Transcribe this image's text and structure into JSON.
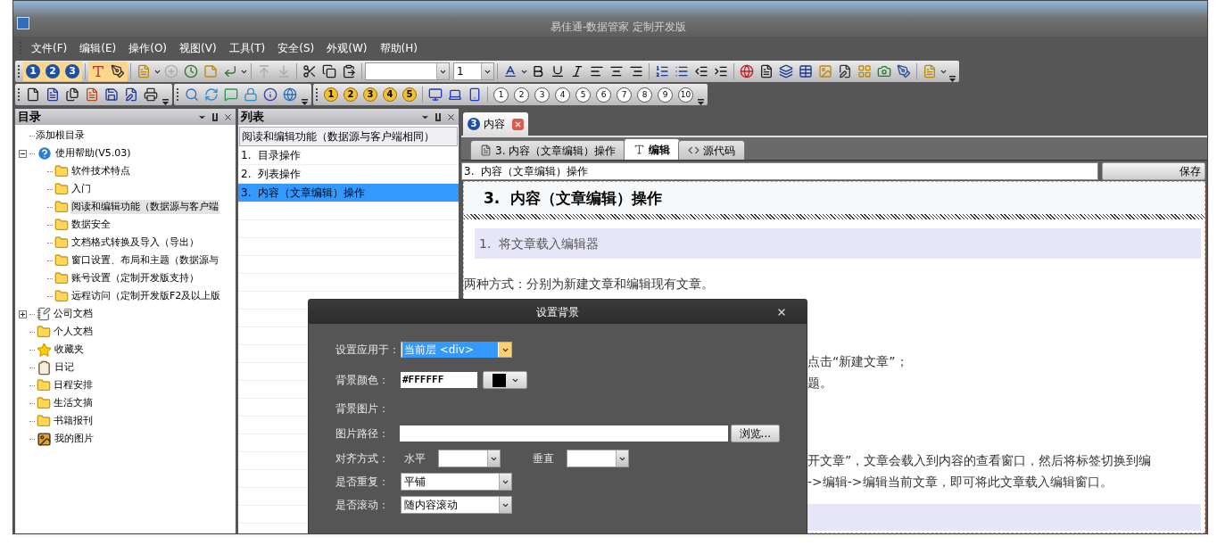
{
  "window": {
    "title": "易佳通-数据管家 定制开发版"
  },
  "menu": [
    "文件(F)",
    "编辑(E)",
    "操作(O)",
    "视图(V)",
    "工具(T)",
    "安全(S)",
    "外观(W)",
    "帮助(H)"
  ],
  "toolbar1": {
    "level_buttons": [
      "1",
      "2",
      "3"
    ],
    "size_field": {
      "value": "1"
    }
  },
  "toolbar2": {
    "yellow_numbers": [
      "1",
      "2",
      "3",
      "4",
      "5"
    ],
    "white_numbers": [
      "1",
      "2",
      "3",
      "4",
      "5",
      "6",
      "7",
      "8",
      "9",
      "10"
    ]
  },
  "directory_panel": {
    "title": "目录",
    "tree": [
      {
        "label": "添加根目录",
        "kind": "plain",
        "selected": false
      },
      {
        "label": "使用帮助(V5.03)",
        "kind": "help",
        "selected": false,
        "expanded": true,
        "children": [
          {
            "label": "软件技术特点",
            "kind": "doc-folder",
            "selected": false
          },
          {
            "label": "入门",
            "kind": "doc-folder",
            "selected": false
          },
          {
            "label": "阅读和编辑功能（数据源与客户端",
            "kind": "doc-folder",
            "selected": true
          },
          {
            "label": "数据安全",
            "kind": "doc-folder",
            "selected": false
          },
          {
            "label": "文档格式转换及导入（导出）",
            "kind": "doc-folder",
            "selected": false
          },
          {
            "label": "窗口设置、布局和主题（数据源与",
            "kind": "doc-folder",
            "selected": false
          },
          {
            "label": "账号设置（定制开发版支持）",
            "kind": "doc-folder",
            "selected": false
          },
          {
            "label": "远程访问（定制开发版F2及以上版",
            "kind": "doc-folder",
            "selected": false
          }
        ]
      },
      {
        "label": "公司文档",
        "kind": "note",
        "selected": false,
        "expanded": false
      },
      {
        "label": "个人文档",
        "kind": "folder",
        "selected": false
      },
      {
        "label": "收藏夹",
        "kind": "star",
        "selected": false
      },
      {
        "label": "日记",
        "kind": "clipboard",
        "selected": false
      },
      {
        "label": "日程安排",
        "kind": "folder",
        "selected": false
      },
      {
        "label": "生活文摘",
        "kind": "folder",
        "selected": false
      },
      {
        "label": "书籍报刊",
        "kind": "folder",
        "selected": false
      },
      {
        "label": "我的图片",
        "kind": "picture",
        "selected": false
      }
    ]
  },
  "list_panel": {
    "title": "列表",
    "header": "阅读和编辑功能（数据源与客户端相同）",
    "items": [
      {
        "label": "1.  目录操作",
        "selected": false
      },
      {
        "label": "2.  列表操作",
        "selected": false
      },
      {
        "label": "3.  内容（文章编辑）操作",
        "selected": true
      }
    ]
  },
  "document_tab": {
    "number": "3",
    "label": "内容"
  },
  "view_tabs": [
    {
      "label": "3. 内容（文章编辑）操作",
      "kind": "view",
      "selected": false
    },
    {
      "label": "编辑",
      "kind": "edit",
      "selected": true
    },
    {
      "label": "源代码",
      "kind": "source",
      "selected": false
    }
  ],
  "title_field": {
    "value": "3.  内容（文章编辑）操作"
  },
  "save_button": {
    "label": "保存"
  },
  "article": {
    "heading": "3.  内容（文章编辑）操作",
    "section": "1.  将文章载入编辑器",
    "intro": "两种方式：分别为新建文章和编辑现有文章。",
    "fragments_1": [
      "点击“新建文章”；",
      "题。"
    ],
    "fragments_2": [
      "开文章”，文章会载入到内容的查看窗口，然后将标签切换到编",
      "->编辑->编辑当前文章，即可将此文章载入编辑窗口。"
    ]
  },
  "dialog": {
    "title": "设置背景",
    "apply_to": {
      "label": "设置应用于：",
      "value": "当前层 <div>"
    },
    "color": {
      "label": "背景颜色：",
      "value": "#FFFFFF"
    },
    "image_label": "背景图片：",
    "path": {
      "label": "图片路径：",
      "browse": "浏览..."
    },
    "align": {
      "label": "对齐方式：",
      "horizontal": "水平",
      "vertical": "垂直"
    },
    "repeat": {
      "label": "是否重复：",
      "value": "平铺"
    },
    "scroll": {
      "label": "是否滚动：",
      "value": "随内容滚动"
    }
  }
}
